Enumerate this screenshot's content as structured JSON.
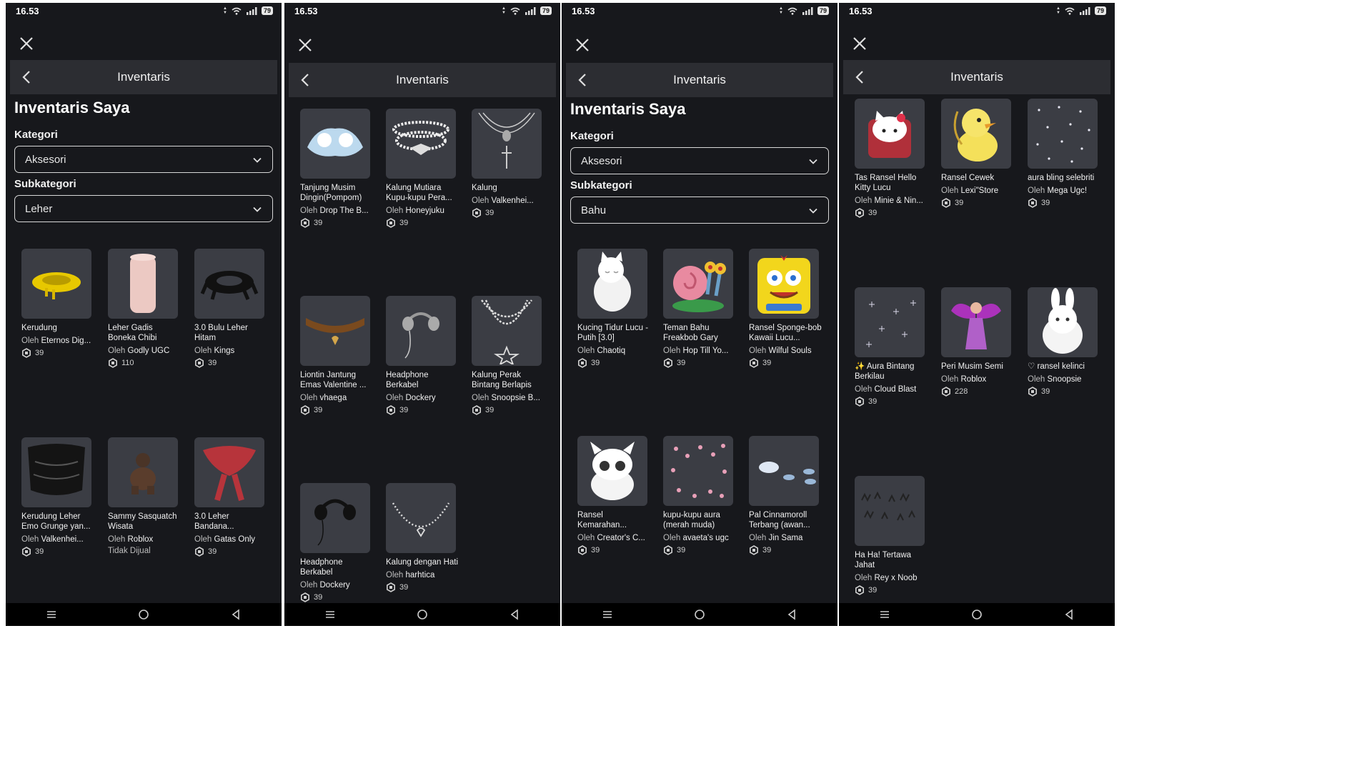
{
  "status": {
    "time": "16.53",
    "battery": "79"
  },
  "app": {
    "header_title": "Inventaris",
    "page_title": "Inventaris Saya",
    "category_label": "Kategori",
    "subcategory_label": "Subkategori",
    "by_prefix": "Oleh"
  },
  "panels": [
    {
      "category": "Aksesori",
      "subcategory": "Leher",
      "items": [
        {
          "name": "Kerudung",
          "creator": "Eternos Dig...",
          "price": "39"
        },
        {
          "name": "Leher Gadis Boneka Chibi",
          "creator": "Godly UGC",
          "price": "110"
        },
        {
          "name": "3.0 Bulu Leher Hitam",
          "creator": "Kings",
          "price": "39"
        },
        {
          "name": "Kerudung Leher Emo Grunge yan...",
          "creator": "Valkenhei...",
          "price": "39"
        },
        {
          "name": "Sammy Sasquatch Wisata",
          "creator": "Roblox",
          "offsale": "Tidak Dijual"
        },
        {
          "name": "3.0 Leher Bandana...",
          "creator": "Gatas Only",
          "price": "39"
        }
      ]
    },
    {
      "items": [
        {
          "name": "Tanjung Musim Dingin(Pompom)",
          "creator": "Drop The B...",
          "price": "39"
        },
        {
          "name": "Kalung Mutiara Kupu-kupu Pera...",
          "creator": "Honeyjuku",
          "price": "39"
        },
        {
          "name": "Kalung",
          "creator": "Valkenhei...",
          "price": "39"
        },
        {
          "name": "Liontin Jantung Emas Valentine ...",
          "creator": "vhaega",
          "price": "39"
        },
        {
          "name": "Headphone Berkabel",
          "creator": "Dockery",
          "price": "39"
        },
        {
          "name": "Kalung Perak Bintang Berlapis",
          "creator": "Snoopsie B...",
          "price": "39"
        },
        {
          "name": "Headphone Berkabel",
          "creator": "Dockery",
          "price": "39"
        },
        {
          "name": "Kalung dengan Hati",
          "creator": "harhtica",
          "price": "39"
        }
      ]
    },
    {
      "category": "Aksesori",
      "subcategory": "Bahu",
      "items": [
        {
          "name": "Kucing Tidur Lucu - Putih [3.0]",
          "creator": "Chaotiq",
          "price": "39"
        },
        {
          "name": "Teman Bahu Freakbob Gary",
          "creator": "Hop Till Yo...",
          "price": "39"
        },
        {
          "name": "Ransel Sponge-bob Kawaii Lucu...",
          "creator": "Wilful Souls",
          "price": "39"
        },
        {
          "name": "Ransel Kemarahan...",
          "creator": "Creator's C...",
          "price": "39"
        },
        {
          "name": "kupu-kupu aura (merah muda)",
          "creator": "avaeta's ugc",
          "price": "39"
        },
        {
          "name": "Pal Cinnamoroll Terbang (awan...",
          "creator": "Jin Sama",
          "price": "39"
        }
      ]
    },
    {
      "items": [
        {
          "name": "Tas Ransel Hello Kitty Lucu",
          "creator": "Minie & Nin...",
          "price": "39"
        },
        {
          "name": "Ransel Cewek",
          "creator": "Lexi\"Store",
          "price": "39"
        },
        {
          "name": "aura bling selebriti",
          "creator": "Mega Ugc!",
          "price": "39"
        },
        {
          "name": "✨ Aura Bintang Berkilau",
          "creator": "Cloud Blast",
          "price": "39"
        },
        {
          "name": "Peri Musim Semi",
          "creator": "Roblox",
          "price": "228"
        },
        {
          "name": "♡ ransel kelinci",
          "creator": "Snoopsie",
          "price": "39"
        },
        {
          "name": "Ha Ha! Tertawa Jahat",
          "creator": "Rey x Noob",
          "price": "39"
        }
      ]
    }
  ]
}
